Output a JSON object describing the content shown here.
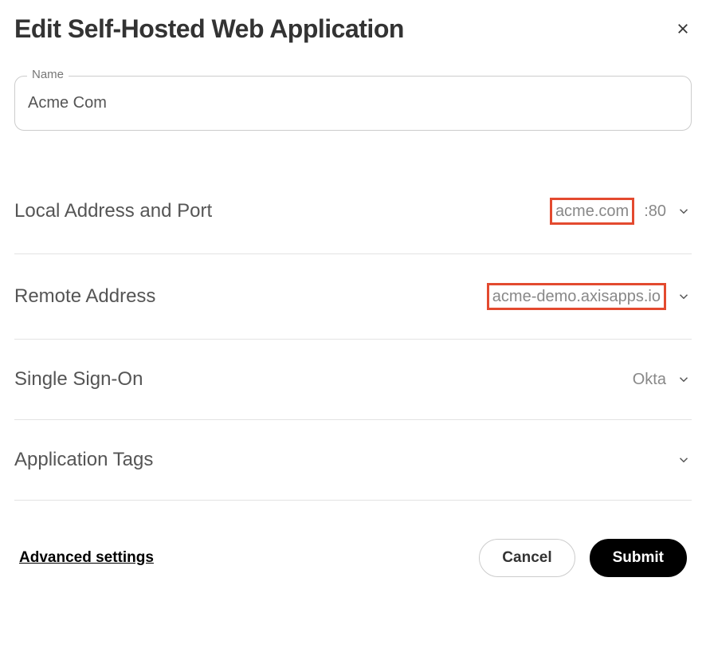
{
  "header": {
    "title": "Edit Self-Hosted Web Application"
  },
  "nameField": {
    "label": "Name",
    "value": "Acme Com"
  },
  "sections": {
    "localAddress": {
      "label": "Local Address and Port",
      "host": "acme.com",
      "port": ":80"
    },
    "remoteAddress": {
      "label": "Remote Address",
      "value": "acme-demo.axisapps.io"
    },
    "sso": {
      "label": "Single Sign-On",
      "value": "Okta"
    },
    "appTags": {
      "label": "Application Tags"
    }
  },
  "footer": {
    "advanced": "Advanced settings",
    "cancel": "Cancel",
    "submit": "Submit"
  }
}
